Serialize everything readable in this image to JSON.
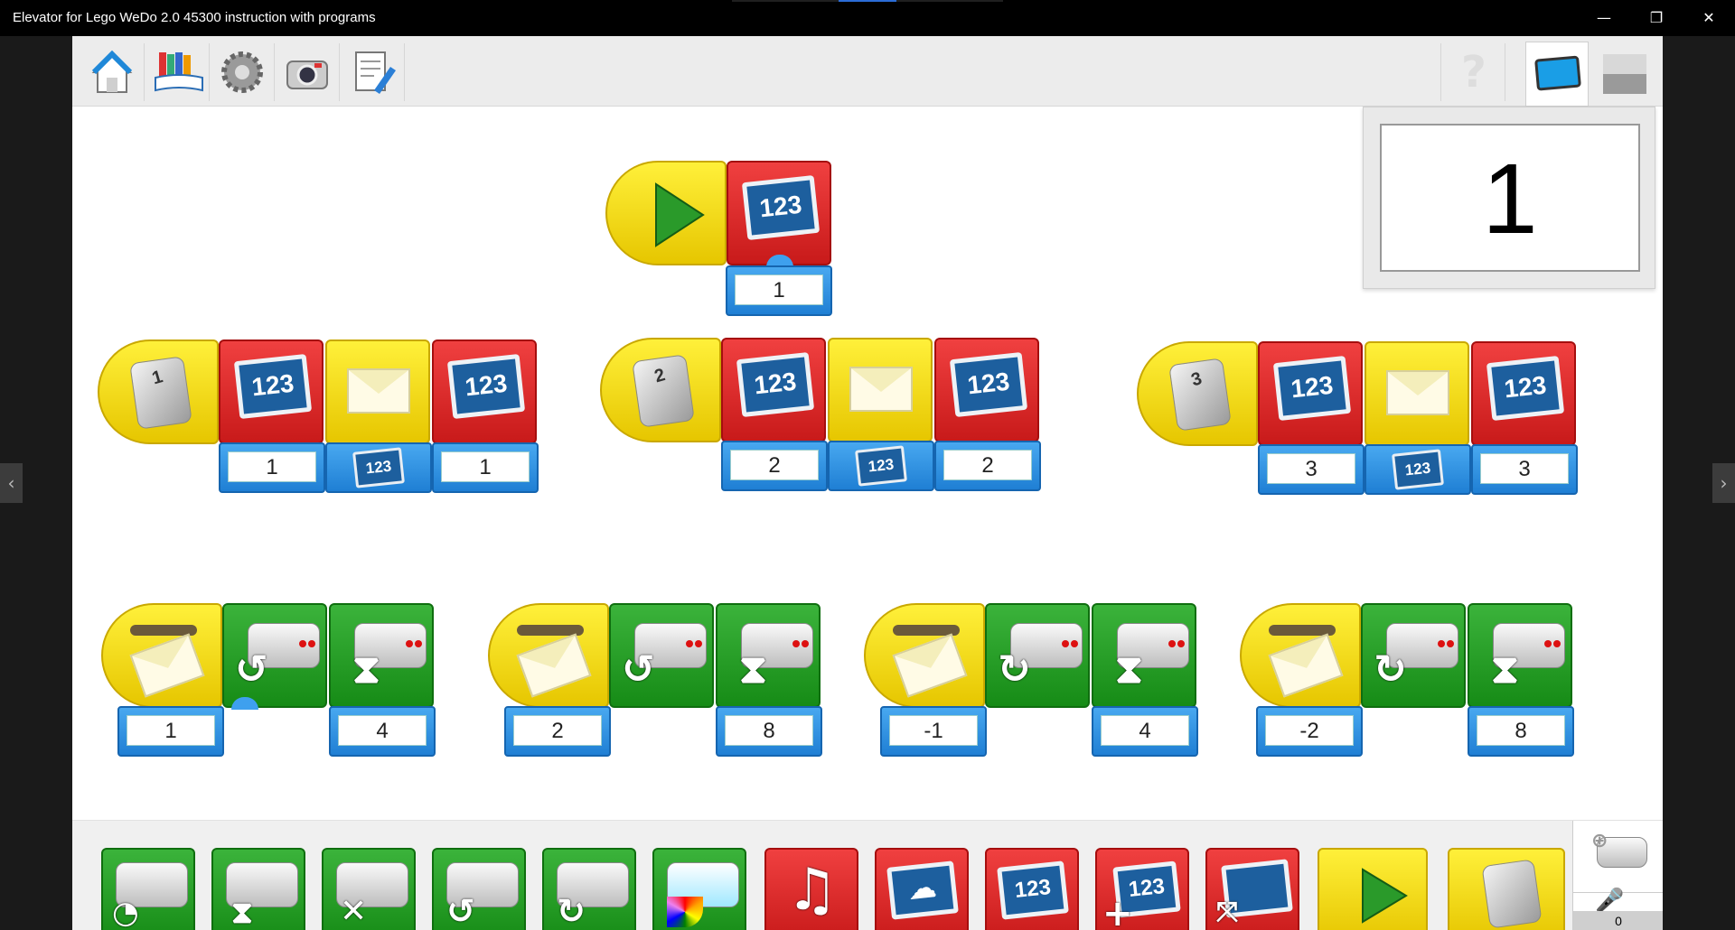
{
  "window": {
    "title": "Elevator for Lego WeDo 2.0 45300 instruction with programs",
    "minimize": "—",
    "restore": "❐",
    "close": "✕"
  },
  "nav": {
    "left_arrow": "‹",
    "right_arrow": "›"
  },
  "toolbar": {
    "icons": [
      "home-icon",
      "library-icon",
      "settings-gear-icon",
      "camera-icon",
      "document-edit-icon"
    ],
    "help_icon": "?",
    "views": [
      "display-view-tab",
      "hidden-view-tab"
    ]
  },
  "display_panel": {
    "value": "1"
  },
  "programs": {
    "start": {
      "display_label": "123",
      "value": "1"
    },
    "keys": [
      {
        "key": "1",
        "display_label": "123",
        "value_a": "1",
        "msg_label": "123",
        "value_b": "1"
      },
      {
        "key": "2",
        "display_label": "123",
        "value_a": "2",
        "msg_label": "123",
        "value_b": "2"
      },
      {
        "key": "3",
        "display_label": "123",
        "value_a": "3",
        "msg_label": "123",
        "value_b": "3"
      }
    ],
    "messages": [
      {
        "msg": "1",
        "wait": "4"
      },
      {
        "msg": "2",
        "wait": "8"
      },
      {
        "msg": "-1",
        "wait": "4"
      },
      {
        "msg": "-2",
        "wait": "8"
      }
    ]
  },
  "palette": {
    "blocks": [
      "motor-speed",
      "motor-on-for",
      "motor-off",
      "motor-counterclockwise",
      "motor-clockwise",
      "light",
      "sound",
      "display-background",
      "display-number",
      "display-add",
      "display-shrink",
      "start",
      "key-start"
    ],
    "display_label": "123",
    "count": "0"
  },
  "colors": {
    "red": "#dd2222",
    "green": "#21a021",
    "yellow": "#f5dc10",
    "blue": "#2b8ae0"
  }
}
